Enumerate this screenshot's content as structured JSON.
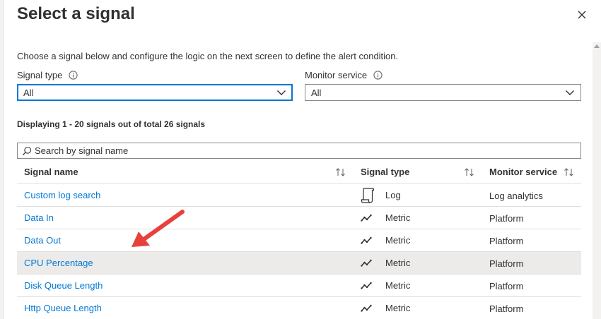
{
  "panel": {
    "title": "Select a signal",
    "description": "Choose a signal below and configure the logic on the next screen to define the alert condition."
  },
  "filters": {
    "signal_type": {
      "label": "Signal type",
      "value": "All"
    },
    "monitor_service": {
      "label": "Monitor service",
      "value": "All"
    }
  },
  "summary": "Displaying 1 - 20 signals out of total 26 signals",
  "search": {
    "placeholder": "Search by signal name"
  },
  "table": {
    "columns": [
      "Signal name",
      "Signal type",
      "Monitor service"
    ],
    "rows": [
      {
        "name": "Custom log search",
        "type": "Log",
        "service": "Log analytics",
        "icon": "log-scroll-icon"
      },
      {
        "name": "Data In",
        "type": "Metric",
        "service": "Platform",
        "icon": "metric-line-icon"
      },
      {
        "name": "Data Out",
        "type": "Metric",
        "service": "Platform",
        "icon": "metric-line-icon"
      },
      {
        "name": "CPU Percentage",
        "type": "Metric",
        "service": "Platform",
        "icon": "metric-line-icon",
        "selected": true
      },
      {
        "name": "Disk Queue Length",
        "type": "Metric",
        "service": "Platform",
        "icon": "metric-line-icon"
      },
      {
        "name": "Http Queue Length",
        "type": "Metric",
        "service": "Platform",
        "icon": "metric-line-icon"
      }
    ]
  },
  "colors": {
    "link": "#0078d4",
    "focus_border": "#0078d4",
    "selected_row": "#edebe9",
    "annotation_arrow": "#e8413c"
  },
  "icons": {
    "close": "close-icon",
    "info": "info-icon",
    "chevron": "chevron-down-icon",
    "search": "search-icon",
    "sort": "sort-icon",
    "annotation": "annotation-arrow-icon"
  }
}
